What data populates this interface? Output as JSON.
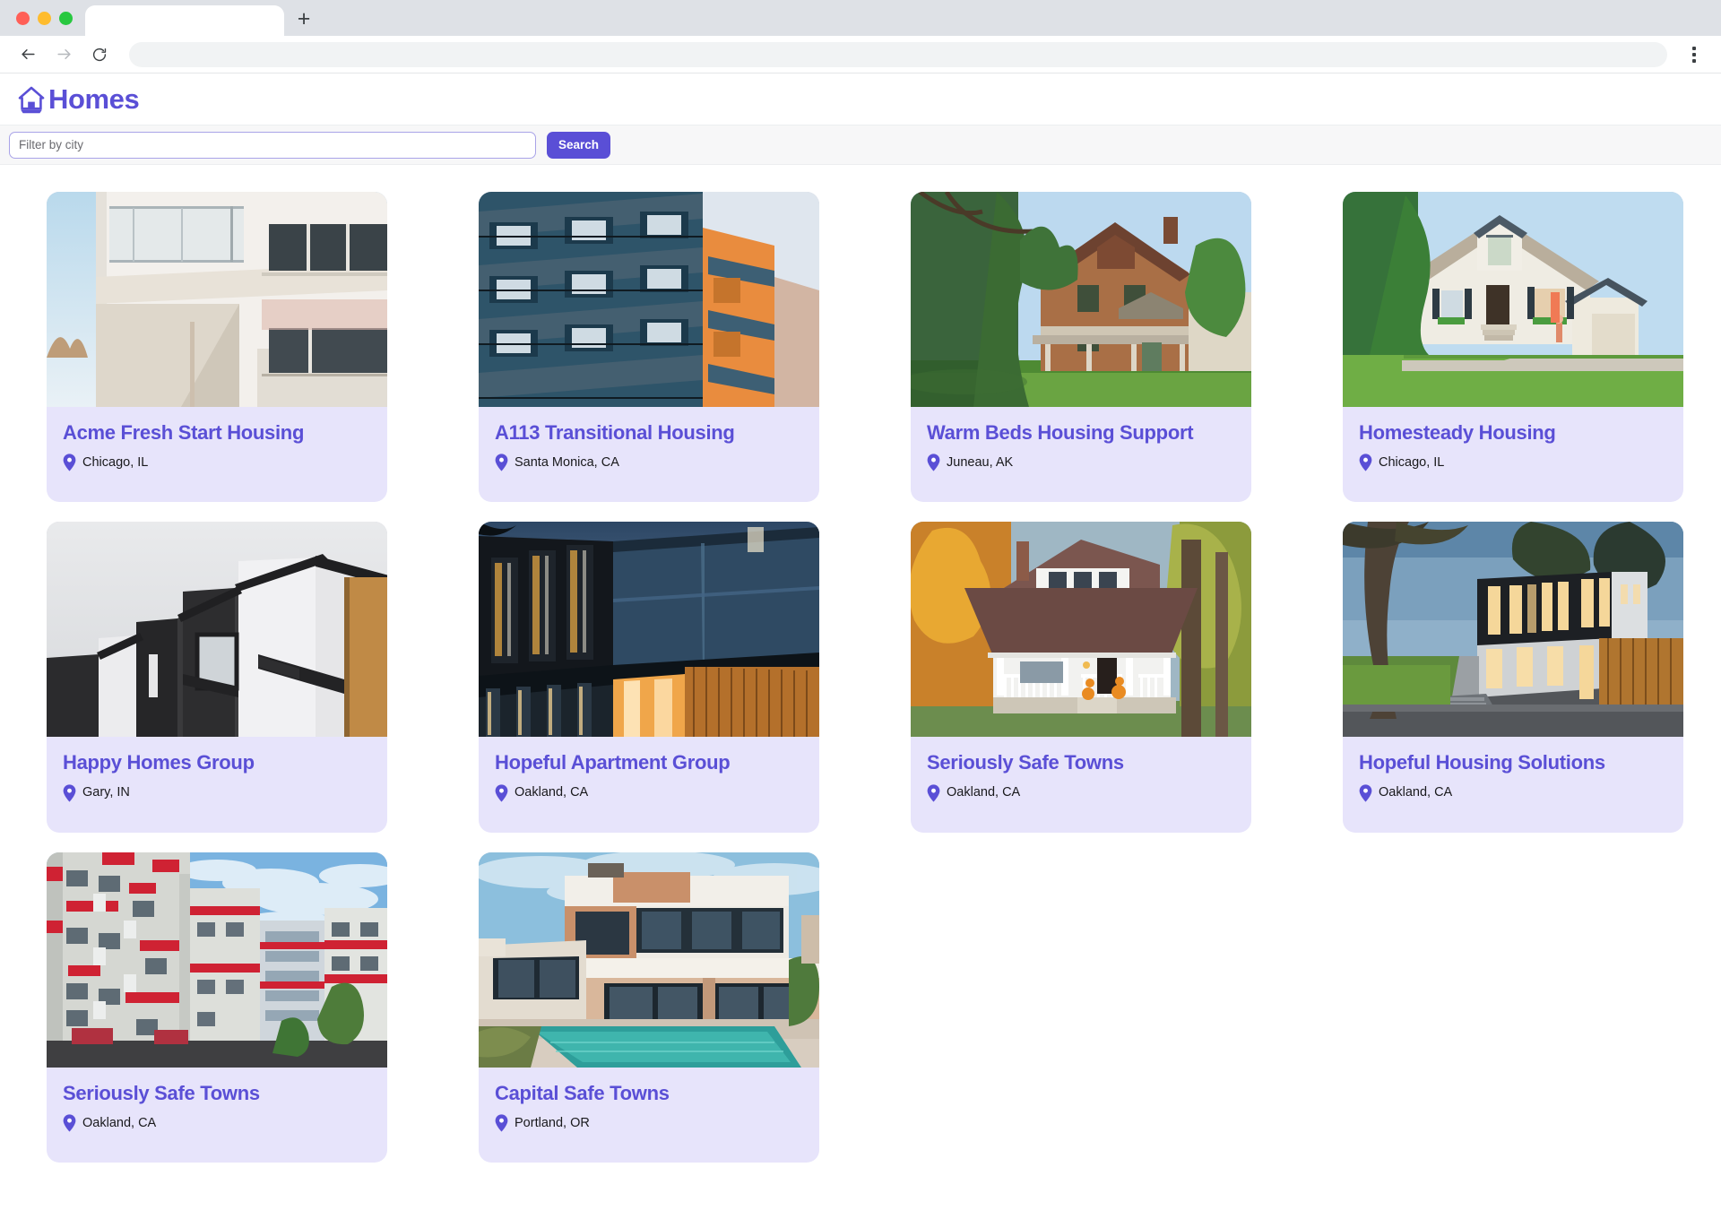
{
  "browser": {
    "tab_title": "",
    "address_value": "",
    "back_icon": "back-arrow-icon",
    "forward_icon": "forward-arrow-icon",
    "reload_icon": "reload-icon",
    "newtab_label": "+",
    "menu_icon": "kebab-menu-icon"
  },
  "app": {
    "brand_name": "Homes",
    "brand_icon": "house-icon",
    "accent_color": "#5a4fd6",
    "card_bg_color": "#e7e4fb"
  },
  "search": {
    "placeholder": "Filter by city",
    "value": "",
    "button_label": "Search"
  },
  "cards": [
    {
      "title": "Acme Fresh Start Housing",
      "city": "Chicago, IL",
      "image_alt": "modern white apartment balcony exterior",
      "pin_icon": "location-pin-icon"
    },
    {
      "title": "A113 Transitional Housing",
      "city": "Santa Monica, CA",
      "image_alt": "blue and orange apartment block with balconies",
      "pin_icon": "location-pin-icon"
    },
    {
      "title": "Warm Beds Housing Support",
      "city": "Juneau, AK",
      "image_alt": "brick victorian house with green trees and lawn",
      "pin_icon": "location-pin-icon"
    },
    {
      "title": "Homesteady Housing",
      "city": "Chicago, IL",
      "image_alt": "white cottage with shingled roof and green lawn",
      "pin_icon": "location-pin-icon"
    },
    {
      "title": "Happy Homes Group",
      "city": "Gary, IN",
      "image_alt": "monochrome modern townhouses against grey sky",
      "pin_icon": "location-pin-icon"
    },
    {
      "title": "Hopeful Apartment Group",
      "city": "Oakland, CA",
      "image_alt": "dark blue modern apartment lit at dusk",
      "pin_icon": "location-pin-icon"
    },
    {
      "title": "Seriously Safe Towns",
      "city": "Oakland, CA",
      "image_alt": "white bungalow with porch and autumn trees",
      "pin_icon": "location-pin-icon"
    },
    {
      "title": "Hopeful Housing Solutions",
      "city": "Oakland, CA",
      "image_alt": "black modern home lit at dusk beside large tree",
      "pin_icon": "location-pin-icon"
    },
    {
      "title": "Seriously Safe Towns",
      "city": "Oakland, CA",
      "image_alt": "white and red high rise apartment towers under blue sky",
      "pin_icon": "location-pin-icon"
    },
    {
      "title": "Capital Safe Towns",
      "city": "Portland, OR",
      "image_alt": "modern villa with infinity pool",
      "pin_icon": "location-pin-icon"
    }
  ]
}
